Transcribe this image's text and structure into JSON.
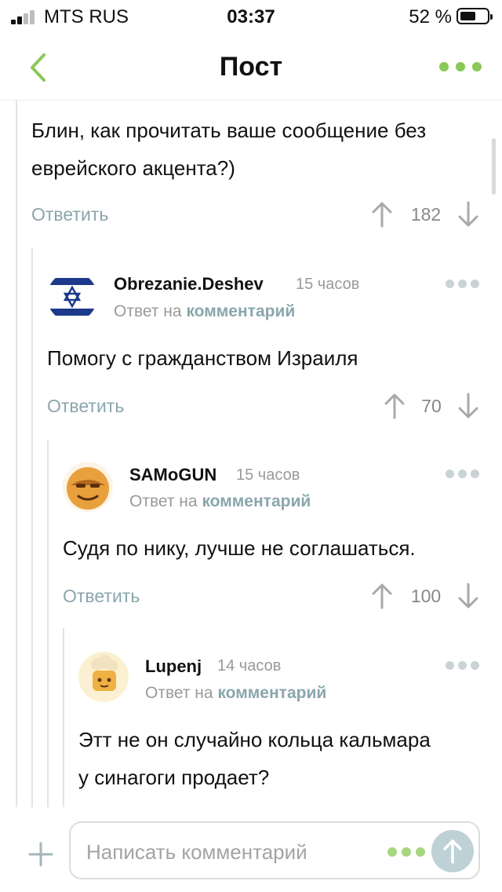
{
  "status_bar": {
    "carrier": "MTS RUS",
    "time": "03:37",
    "battery": "52 %"
  },
  "header": {
    "title": "Пост"
  },
  "colors": {
    "accent": "#8ac858",
    "reply_link": "#8aa6ad",
    "muted": "#9a9a9a"
  },
  "comments": [
    {
      "text_lines": [
        "Блин, как прочитать ваше сообщение без",
        "еврейского акцента?)"
      ],
      "reply_label": "Ответить",
      "score": "182"
    },
    {
      "author": "Obrezanie.Deshev",
      "time": "15 часов",
      "reply_prefix": "Ответ на",
      "reply_link": "комментарий",
      "text_lines": [
        "Помогу с гражданством Израиля"
      ],
      "reply_label": "Ответить",
      "score": "70",
      "avatar_icon": "israel-flag"
    },
    {
      "author": "SAMoGUN",
      "time": "15 часов",
      "reply_prefix": "Ответ на",
      "reply_link": "комментарий",
      "text_lines": [
        "Судя по нику, лучше не соглашаться."
      ],
      "reply_label": "Ответить",
      "score": "100",
      "avatar_icon": "smiling-face"
    },
    {
      "author": "Lupenj",
      "time": "14 часов",
      "reply_prefix": "Ответ на",
      "reply_link": "комментарий",
      "text_lines": [
        "Этт не он случайно кольца кальмара",
        "у синагоги продает?"
      ],
      "avatar_icon": "cook-character"
    }
  ],
  "composer": {
    "placeholder": "Написать комментарий"
  }
}
